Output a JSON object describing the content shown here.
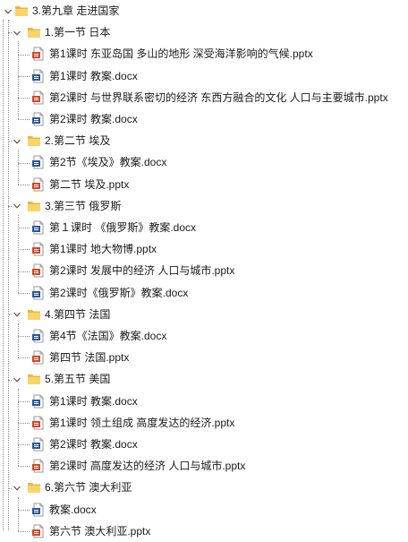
{
  "tree": {
    "root": {
      "label": "3.第九章 走进国家"
    },
    "sections": [
      {
        "label": "1.第一节 日本",
        "files": [
          {
            "label": "第1课时 东亚岛国 多山的地形 深受海洋影响的气候.pptx",
            "type": "pptx"
          },
          {
            "label": "第1课时 教案.docx",
            "type": "docx"
          },
          {
            "label": "第2课时 与世界联系密切的经济 东西方融合的文化 人口与主要城市.pptx",
            "type": "pptx"
          },
          {
            "label": "第2课时 教案.docx",
            "type": "docx"
          }
        ]
      },
      {
        "label": "2.第二节 埃及",
        "files": [
          {
            "label": "第2节《埃及》教案.docx",
            "type": "docx"
          },
          {
            "label": "第二节 埃及.pptx",
            "type": "pptx"
          }
        ]
      },
      {
        "label": "3.第三节 俄罗斯",
        "files": [
          {
            "label": "第１课时 《俄罗斯》教案.docx",
            "type": "docx"
          },
          {
            "label": "第1课时 地大物博.pptx",
            "type": "pptx"
          },
          {
            "label": "第2课时 发展中的经济 人口与城市.pptx",
            "type": "pptx"
          },
          {
            "label": "第2课时《俄罗斯》教案.docx",
            "type": "docx"
          }
        ]
      },
      {
        "label": "4.第四节 法国",
        "files": [
          {
            "label": "第4节《法国》教案.docx",
            "type": "docx"
          },
          {
            "label": "第四节 法国.pptx",
            "type": "pptx"
          }
        ]
      },
      {
        "label": "5.第五节 美国",
        "files": [
          {
            "label": "第1课时 教案.docx",
            "type": "docx"
          },
          {
            "label": "第1课时 领土组成 高度发达的经济.pptx",
            "type": "pptx"
          },
          {
            "label": "第2课时 教案.docx",
            "type": "docx"
          },
          {
            "label": "第2课时 高度发达的经济 人口与城市.pptx",
            "type": "pptx"
          }
        ]
      },
      {
        "label": "6.第六节 澳大利亚",
        "files": [
          {
            "label": "教案.docx",
            "type": "docx"
          },
          {
            "label": "第六节 澳大利亚.pptx",
            "type": "pptx"
          }
        ]
      }
    ]
  },
  "icons": {
    "folder": "folder-icon",
    "pptx": "pptx-file-icon",
    "docx": "docx-file-icon",
    "toggle": "collapse-toggle-icon"
  },
  "colors": {
    "folder_back": "#e9b93b",
    "folder_front": "#f8d46a",
    "pptx_accent": "#d24726",
    "docx_accent": "#2b5797",
    "guide_line": "#8a8a8a"
  }
}
